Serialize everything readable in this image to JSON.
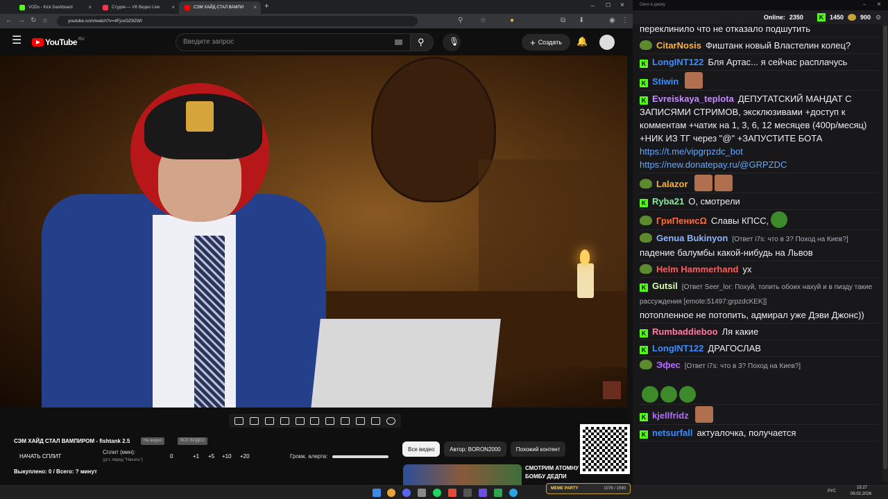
{
  "browser": {
    "tabs": [
      {
        "title": "VODs - Kick Dashboard",
        "color": "#53fc18"
      },
      {
        "title": "Студия — VK Видео Live",
        "color": "#ff3347"
      },
      {
        "title": "СЭМ ХАЙД СТАЛ ВАМПИ",
        "color": "#ff0000"
      }
    ],
    "new_tab": "+",
    "url": "youtube.com/watch?v=4FjcxOZ9ZWI"
  },
  "youtube": {
    "logo_text": "YouTube",
    "region": "RU",
    "search_placeholder": "Введите запрос",
    "create_label": "Создать"
  },
  "controls": {
    "title": "СЭМ ХАЙД СТАЛ ВАМПИРОМ - fishtank 2.5",
    "badge1": "На видео",
    "badge2": "ВСЕ ВИДЕО",
    "start_split": "НАЧАТЬ СПЛИТ",
    "split_label": "Сплит (мин):",
    "split_hint": "(уст. перед \"Начать\")",
    "split_value": "0",
    "inc": [
      "+1",
      "+5",
      "+10",
      "+20"
    ],
    "volume_label": "Громк. алерта:",
    "volume": 1.0,
    "bought": "Выкуплено: 0 / Всего: ? минут"
  },
  "sidebar": {
    "chips": [
      "Все видео",
      "Автор: BORON2000",
      "Похожий контент"
    ],
    "video_title": "СМОТРИМ АТОМНУ БОМБУ ДЕДПИ ВМЕСТЕ С ..."
  },
  "chat": {
    "window_title": "Окно в джаку",
    "online_label": "Online:",
    "online": "2350",
    "kicks": "1450",
    "coins": "900",
    "messages": [
      {
        "badge": "none",
        "user": "",
        "color": "#efeff1",
        "reply": "",
        "text": "переклинило что не отказало подшутить"
      },
      {
        "badge": "pepe",
        "user": "CitarNosis",
        "color": "#ffb13b",
        "reply": "",
        "text": "Фиштанк новый Властелин колец?"
      },
      {
        "badge": "kick",
        "user": "LongINT122",
        "color": "#3a8dff",
        "reply": "",
        "text": "Бля Артас... я сейчас расплачусь"
      },
      {
        "badge": "kick",
        "user": "Stiwin",
        "color": "#3a8dff",
        "reply": "",
        "text": ""
      },
      {
        "badge": "kick",
        "user": "Evreiskaya_teplota",
        "color": "#c58cff",
        "reply": "",
        "text": "ДЕПУТАТСКИЙ МАНДАТ С ЗАПИСЯМИ СТРИМОВ, эксклюзивами +доступ к комментам +чатик на 1, 3, 6, 12 месяцев (400р/месяц) +НИК ИЗ ТГ через \"@\" +ЗАПУСТИТЕ БОТА",
        "link1": "https://t.me/vipgrpzdc_bot",
        "link2": "https://new.donatepay.ru/@GRPZDC"
      },
      {
        "badge": "pepe",
        "user": "Lalazor",
        "color": "#ffb13b",
        "reply": "",
        "text": ""
      },
      {
        "badge": "kick",
        "user": "Ryba21",
        "color": "#8fe6a5",
        "reply": "",
        "text": "О, смотрели"
      },
      {
        "badge": "pepe",
        "user": "ГриПенисΩ",
        "color": "#ff6a3c",
        "reply": "",
        "text": "Славы КПСС,"
      },
      {
        "badge": "pepe",
        "user": "Genua Bukinyon",
        "color": "#8ab4ff",
        "reply": "[Ответ i7s: что в 3? Поход на Киев?]",
        "text": "падение балумбы какой-нибудь на Львов"
      },
      {
        "badge": "pepe",
        "user": "Helm Hammerhand",
        "color": "#ff5c5c",
        "reply": "",
        "text": "ух"
      },
      {
        "badge": "kick",
        "user": "Gutsil",
        "color": "#d7ffb0",
        "reply": "[Ответ Seer_lor: Похуй, топить обоих нахуй и в пизду такие рассуждения [emote:51497:grpzdcKEK]]",
        "text": "потопленное не потопить, адмирал уже Дэви Джонс))"
      },
      {
        "badge": "kick",
        "user": "Rumbaddieboo",
        "color": "#ff7aa2",
        "reply": "",
        "text": "Ля какие"
      },
      {
        "badge": "kick",
        "user": "LongINT122",
        "color": "#3a8dff",
        "reply": "",
        "text": "ДРАГОСЛАВ"
      },
      {
        "badge": "pepe",
        "user": "Эфес",
        "color": "#b46bff",
        "reply": "[Ответ i7s: что в 3? Поход на Киев?]",
        "text": ""
      },
      {
        "badge": "kick",
        "user": "kjellfridz",
        "color": "#b46bff",
        "reply": "",
        "text": ""
      },
      {
        "badge": "kick",
        "user": "netsurfall",
        "color": "#3a8dff",
        "reply": "",
        "text": "актуалочка, получается"
      }
    ]
  },
  "overlay": {
    "marker": "MEME PARTY",
    "counter": "1076 / 1590"
  },
  "taskbar": {
    "lang": "РУС",
    "time": "15:27",
    "date": "09.02.2026"
  }
}
